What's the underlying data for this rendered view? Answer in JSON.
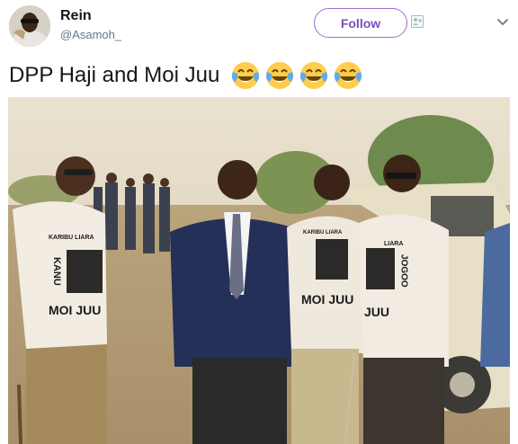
{
  "user": {
    "display_name": "Rein",
    "handle": "@Asamoh_"
  },
  "follow_button": {
    "label": "Follow"
  },
  "tweet": {
    "text": "DPP Haji and Moi Juu",
    "emojis": [
      "face-with-tears-of-joy",
      "face-with-tears-of-joy",
      "face-with-tears-of-joy",
      "face-with-tears-of-joy"
    ]
  },
  "photo": {
    "shirt_text_left_top": "KARIBU LIARA",
    "shirt_text_left_vertical": "KANU",
    "shirt_text_left_bottom": "MOI JUU",
    "shirt_text_mid_top": "KARIBU LIARA",
    "shirt_text_mid_bottom": "MOI JUU",
    "shirt_text_right_top": "LIARA",
    "shirt_text_right_vertical": "JOGOO",
    "shirt_text_right_bottom": "JUU"
  },
  "colors": {
    "follow_border": "#9b6fce",
    "follow_text": "#7c4cbf",
    "handle_text": "#657786",
    "text_primary": "#14171a"
  }
}
